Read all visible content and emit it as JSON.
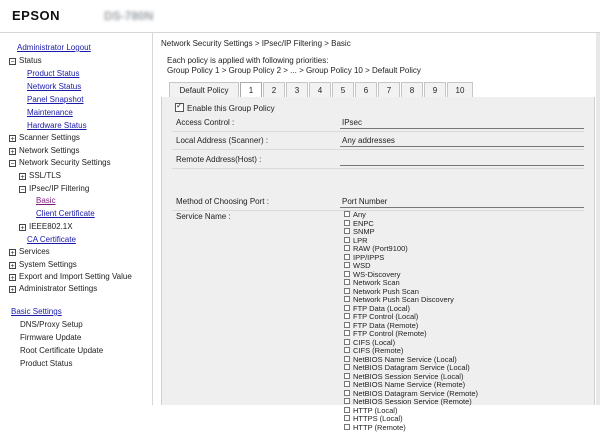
{
  "header": {
    "brand": "EPSON",
    "model": "DS-780N"
  },
  "sidebar": {
    "admin_logout": "Administrator Logout",
    "status": "Status",
    "status_items": [
      "Product Status",
      "Network Status",
      "Panel Snapshot",
      "Maintenance",
      "Hardware Status"
    ],
    "scanner_settings": "Scanner Settings",
    "network_settings": "Network Settings",
    "network_security_settings": "Network Security Settings",
    "ssl_tls": "SSL/TLS",
    "ipsec_ip_filtering": "IPsec/IP Filtering",
    "basic": "Basic",
    "client_certificate": "Client Certificate",
    "ieee8021x": "IEEE802.1X",
    "ca_certificate": "CA Certificate",
    "services": "Services",
    "system_settings": "System Settings",
    "export_import": "Export and Import Setting Value",
    "administrator_settings": "Administrator Settings",
    "basic_settings": "Basic Settings",
    "basic_items": [
      "DNS/Proxy Setup",
      "Firmware Update",
      "Root Certificate Update",
      "Product Status"
    ]
  },
  "main": {
    "breadcrumb": "Network Security Settings > IPsec/IP Filtering > Basic",
    "policy_line1": "Each policy is applied with following priorities:",
    "policy_line2": "Group Policy 1 > Group Policy 2 > ... > Group Policy 10 > Default Policy",
    "tabs": [
      "Default Policy",
      "1",
      "2",
      "3",
      "4",
      "5",
      "6",
      "7",
      "8",
      "9",
      "10"
    ],
    "active_tab": "1",
    "enable_label": "Enable this Group Policy",
    "fields": [
      {
        "label": "Access Control :",
        "value": "IPsec"
      },
      {
        "label": "Local Address (Scanner) :",
        "value": "Any addresses"
      },
      {
        "label": "Remote Address(Host) :",
        "value": ""
      },
      {
        "label": "Method of Choosing Port :",
        "value": "Port Number"
      }
    ],
    "service_name_label": "Service Name :",
    "services": [
      "Any",
      "ENPC",
      "SNMP",
      "LPR",
      "RAW (Port9100)",
      "IPP/IPPS",
      "WSD",
      "WS-Discovery",
      "Network Scan",
      "Network Push Scan",
      "Network Push Scan Discovery",
      "FTP Data (Local)",
      "FTP Control (Local)",
      "FTP Data (Remote)",
      "FTP Control (Remote)",
      "CIFS (Local)",
      "CIFS (Remote)",
      "NetBIOS Name Service (Local)",
      "NetBIOS Datagram Service (Local)",
      "NetBIOS Session Service (Local)",
      "NetBIOS Name Service (Remote)",
      "NetBIOS Datagram Service (Remote)",
      "NetBIOS Session Service (Remote)",
      "HTTP (Local)",
      "HTTPS (Local)",
      "HTTP (Remote)"
    ]
  }
}
